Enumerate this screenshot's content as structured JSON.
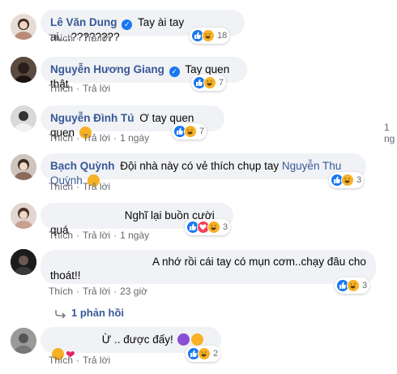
{
  "comments": [
    {
      "author": "Lê Văn Dung",
      "text": "Tay ài tay ai....????????",
      "like": "Thích",
      "reply": "Trả lời",
      "reaction_count": "18"
    },
    {
      "author": "Nguyễn Hương Giang",
      "text": "Tay quen thật",
      "like": "Thích",
      "reply": "Trả lời",
      "reaction_count": "7"
    },
    {
      "author": "Nguyễn Đình Tú",
      "text": "Ơ tay quen quen",
      "like": "Thích",
      "reply": "Trả lời",
      "time": "1 ngày",
      "reaction_count": "7"
    },
    {
      "author": "Bạch Quỳnh",
      "text": "Đội nhà này có vẻ thích chụp tay",
      "mention": "Nguyễn Thu Quỳnh",
      "like": "Thích",
      "reply": "Trả lời",
      "reaction_count": "3"
    },
    {
      "text": "Nghĩ lại buồn cười quá",
      "like": "Thích",
      "reply": "Trả lời",
      "time": "1 ngày",
      "reaction_count": "3"
    },
    {
      "text_line1": "A nhớ rồi cái tay có mụn cơm..chạy đâu cho",
      "text_line2": "thoát!!",
      "like": "Thích",
      "reply": "Trả lời",
      "time": "23 giờ",
      "reaction_count": "3"
    },
    {
      "text": "Ừ .. được đấy!",
      "like": "Thích",
      "reply": "Trả lời",
      "reaction_count": "2"
    }
  ],
  "replies_link": "1 phản hồi",
  "side_time": "1 ng"
}
